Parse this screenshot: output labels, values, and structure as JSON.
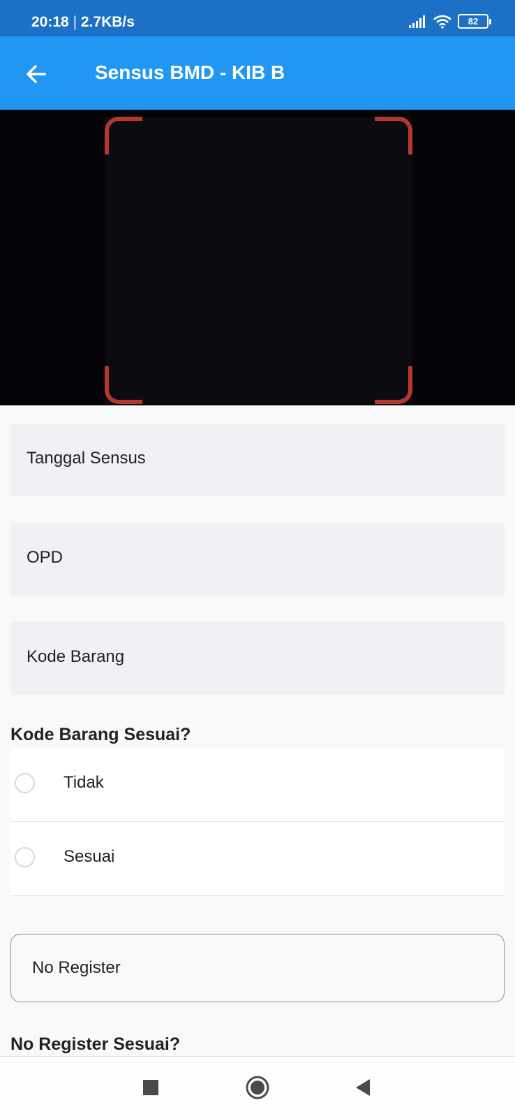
{
  "status_bar": {
    "time": "20:18",
    "separator": "|",
    "speed": "2.7KB/s",
    "battery": "82",
    "icons": [
      "signal-icon",
      "wifi-icon",
      "battery-icon"
    ]
  },
  "app_bar": {
    "title": "Sensus BMD - KIB B",
    "back_icon": "arrow-left-icon",
    "color": "#2196f3"
  },
  "scanner": {
    "frame_color": "#b5382e"
  },
  "form": {
    "fields": [
      {
        "label": "Tanggal Sensus"
      },
      {
        "label": "OPD"
      },
      {
        "label": "Kode Barang"
      }
    ],
    "kode_barang_question": "Kode Barang Sesuai?",
    "kode_barang_options": [
      "Tidak",
      "Sesuai"
    ],
    "no_register_label": "No Register",
    "no_register_question": "No Register Sesuai?"
  },
  "nav_bar": {
    "buttons": [
      "recents-square-icon",
      "home-circle-icon",
      "back-triangle-icon"
    ]
  }
}
